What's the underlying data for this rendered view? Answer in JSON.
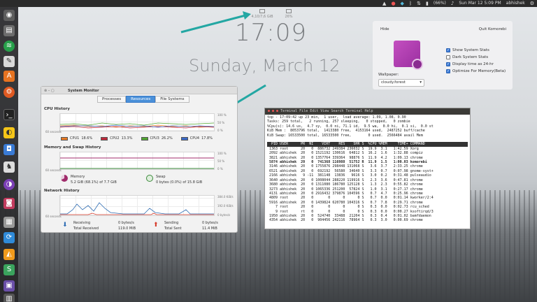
{
  "top_panel": {
    "battery": "(66%)",
    "clock": "Sun Mar 12 5:09 PM",
    "user": "abhishek"
  },
  "lock_screen": {
    "time": "17:09",
    "date": "Sunday, March 12",
    "indicators": [
      {
        "label": "4,10/7,6 GiB"
      },
      {
        "label": "26%"
      }
    ]
  },
  "komorebi": {
    "hide_label": "Hide",
    "quit_label": "Quit Komorebi",
    "wallpaper_label": "Wallpaper:",
    "wallpaper_value": "cloudy.forest",
    "options": [
      {
        "label": "Show System Stats",
        "checked": true
      },
      {
        "label": "Dark System Stats",
        "checked": false
      },
      {
        "label": "Display time as 24-hr",
        "checked": true
      },
      {
        "label": "Optimize For Memory(Beta)",
        "checked": true
      }
    ]
  },
  "system_monitor": {
    "title": "System Monitor",
    "tabs": [
      {
        "label": "Processes",
        "active": false
      },
      {
        "label": "Resources",
        "active": true
      },
      {
        "label": "File Systems",
        "active": false
      }
    ],
    "cpu_title": "CPU History",
    "cpu_legend": [
      {
        "name": "CPU1",
        "value": "18.6%",
        "color": "#e87a24"
      },
      {
        "name": "CPU2",
        "value": "13.3%",
        "color": "#c0283a"
      },
      {
        "name": "CPU3",
        "value": "26.2%",
        "color": "#52a832"
      },
      {
        "name": "CPU4",
        "value": "17.8%",
        "color": "#3a6ac8"
      }
    ],
    "mem_title": "Memory and Swap History",
    "memory_label": "Memory",
    "memory_value": "5.2 GiB (68.1%) of 7.7 GiB",
    "swap_label": "Swap",
    "swap_value": "0 bytes (0.0%) of 15.8 GiB",
    "net_title": "Network History",
    "receiving_label": "Receiving",
    "receiving_value": "0 bytes/s",
    "total_received_label": "Total Received",
    "total_received_value": "119.0 MiB",
    "sending_label": "Sending",
    "sending_value": "0 bytes/s",
    "total_sent_label": "Total Sent",
    "total_sent_value": "11.4 MiB",
    "axis_left": "60 seconds",
    "pct_100": "100 %",
    "pct_50": "50 %",
    "pct_0": "0 %",
    "net_top": "384.0 KiB/s",
    "net_mid": "192.0 KiB/s",
    "net_bot": "0 bytes/s",
    "colors": {
      "memory": "#a02b6b",
      "swap": "#3b8a3b",
      "receiving": "#2f6db3",
      "sending": "#d63a2a"
    }
  },
  "terminal": {
    "menu": "Terminal  File  Edit  View  Search  Terminal  Help",
    "lines": [
      "top - 17:09:42 up 23 min,  1 user,  load average: 1.09, 1.08, 0.90",
      "Tasks: 259 total,   2 running, 257 sleeping,   0 stopped,   0 zombie",
      "%Cpu(s): 14.6 us,  4.7 sy,  0.0 ni, 71.1 id,  9.5 wa,  0.0 hi,  0.1 si,  0.0 st",
      "KiB Mem :  8053796 total,  1413380 free,  4153164 used,  2487252 buff/cache",
      "KiB Swap: 16533500 total, 16533500 free,        0 used.  2566484 avail Mem"
    ],
    "proc_header": "  PID USER      PR  NI    VIRT    RES    SHR S  %CPU %MEM     TIME+ COMMAND",
    "procs": [
      " 1363 root      20   0  886732 249384 236032 S  19.9  3.1   1:42.59 Xorg",
      " 2092 abhishek  20   0 1521192 130616  64812 S  16.2  1.6   1:32.88 compiz",
      " 3821 abhishek  20   0 1357764 339364  98876 S  11.9  4.2   1:09.13 chrome",
      " 5874 abhishek  20   0  741368 116988  51752 R  11.9  1.5   1:00.03 komorebi",
      " 3146 abhishek  20   0 1755876 298448 131068 S   3.6  3.7   2:33.25 chrome",
      " 6521 abhishek  20   0  692192  56580  34640 S   3.3  0.7   0:07.98 gnome-syst+",
      " 2166 abhishek   9 -11  381148  13836   9616 S   3.0  0.2   0:31.48 pulseaudio",
      " 3640 abhishek  20   0 1008044 288220 119916 S   2.3  3.6   0:47.81 chrome",
      " 3680 abhishek  20   0 1311080 186780 125128 S   1.3  2.3   0:55.82 chrome",
      " 3273 abhishek  20   0 1065336 251200  57824 S   1.0  3.1   0:27.17 chrome",
      " 4131 abhishek  20   0 2916432 379876 104596 S   0.7  4.7   0:25.96 chrome",
      " 4809 root      20   0       0      0      0 S   0.7  0.0   0:01.14 kworker/2:4",
      " 5916 abhishek  20   0 1439824 620780 104316 S   0.7  7.8   0:29.71 chrome",
      "    7 root      20   0       0      0      0 S   0.3  0.0   0:02.73 rcu_sched",
      "    9 root      rt   0       0      0      0 S   0.3  0.0   0:00.27 ksoftirqd/3",
      " 1950 abhishek  20   0  524740  33488  21204 S   0.3  0.4   0:01.02 bamfdaemon",
      " 4354 abhishek  20   0  904456 242116  78964 S   0.3  3.0   0:00.69 chrome"
    ]
  }
}
